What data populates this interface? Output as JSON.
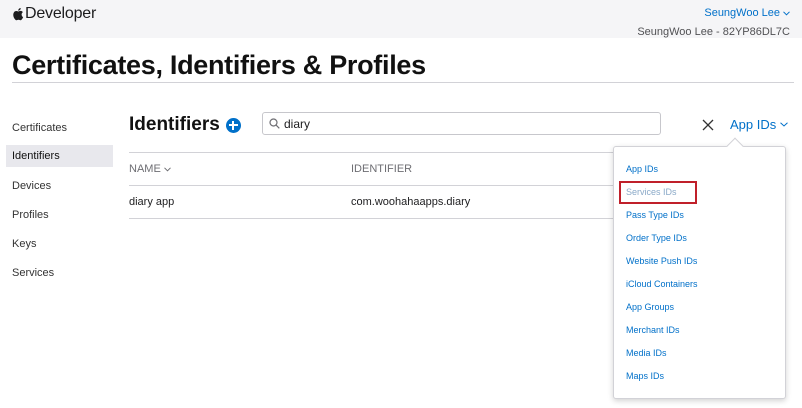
{
  "header": {
    "brand": "Developer",
    "user_name": "SeungWoo Lee",
    "team_line": "SeungWoo Lee - 82YP86DL7C"
  },
  "page": {
    "title": "Certificates, Identifiers & Profiles"
  },
  "sidebar": {
    "items": [
      {
        "label": "Certificates",
        "active": false
      },
      {
        "label": "Identifiers",
        "active": true
      },
      {
        "label": "Devices",
        "active": false
      },
      {
        "label": "Profiles",
        "active": false
      },
      {
        "label": "Keys",
        "active": false
      },
      {
        "label": "Services",
        "active": false
      }
    ]
  },
  "main": {
    "heading": "Identifiers",
    "search": {
      "value": "diary",
      "placeholder": ""
    },
    "type_filter": "App IDs",
    "table": {
      "columns": [
        "NAME",
        "IDENTIFIER"
      ],
      "rows": [
        {
          "name": "diary app",
          "identifier": "com.woohahaapps.diary"
        }
      ]
    }
  },
  "type_menu": {
    "items": [
      "App IDs",
      "Services IDs",
      "Pass Type IDs",
      "Order Type IDs",
      "Website Push IDs",
      "iCloud Containers",
      "App Groups",
      "Merchant IDs",
      "Media IDs",
      "Maps IDs"
    ],
    "highlighted_item": "Services IDs"
  },
  "colors": {
    "accent": "#0070c9",
    "highlight_box": "#c0202a",
    "topbar_bg": "#f5f5f7"
  },
  "icons": [
    "apple-logo",
    "chevron-down-icon",
    "add-icon",
    "search-icon",
    "close-icon"
  ]
}
